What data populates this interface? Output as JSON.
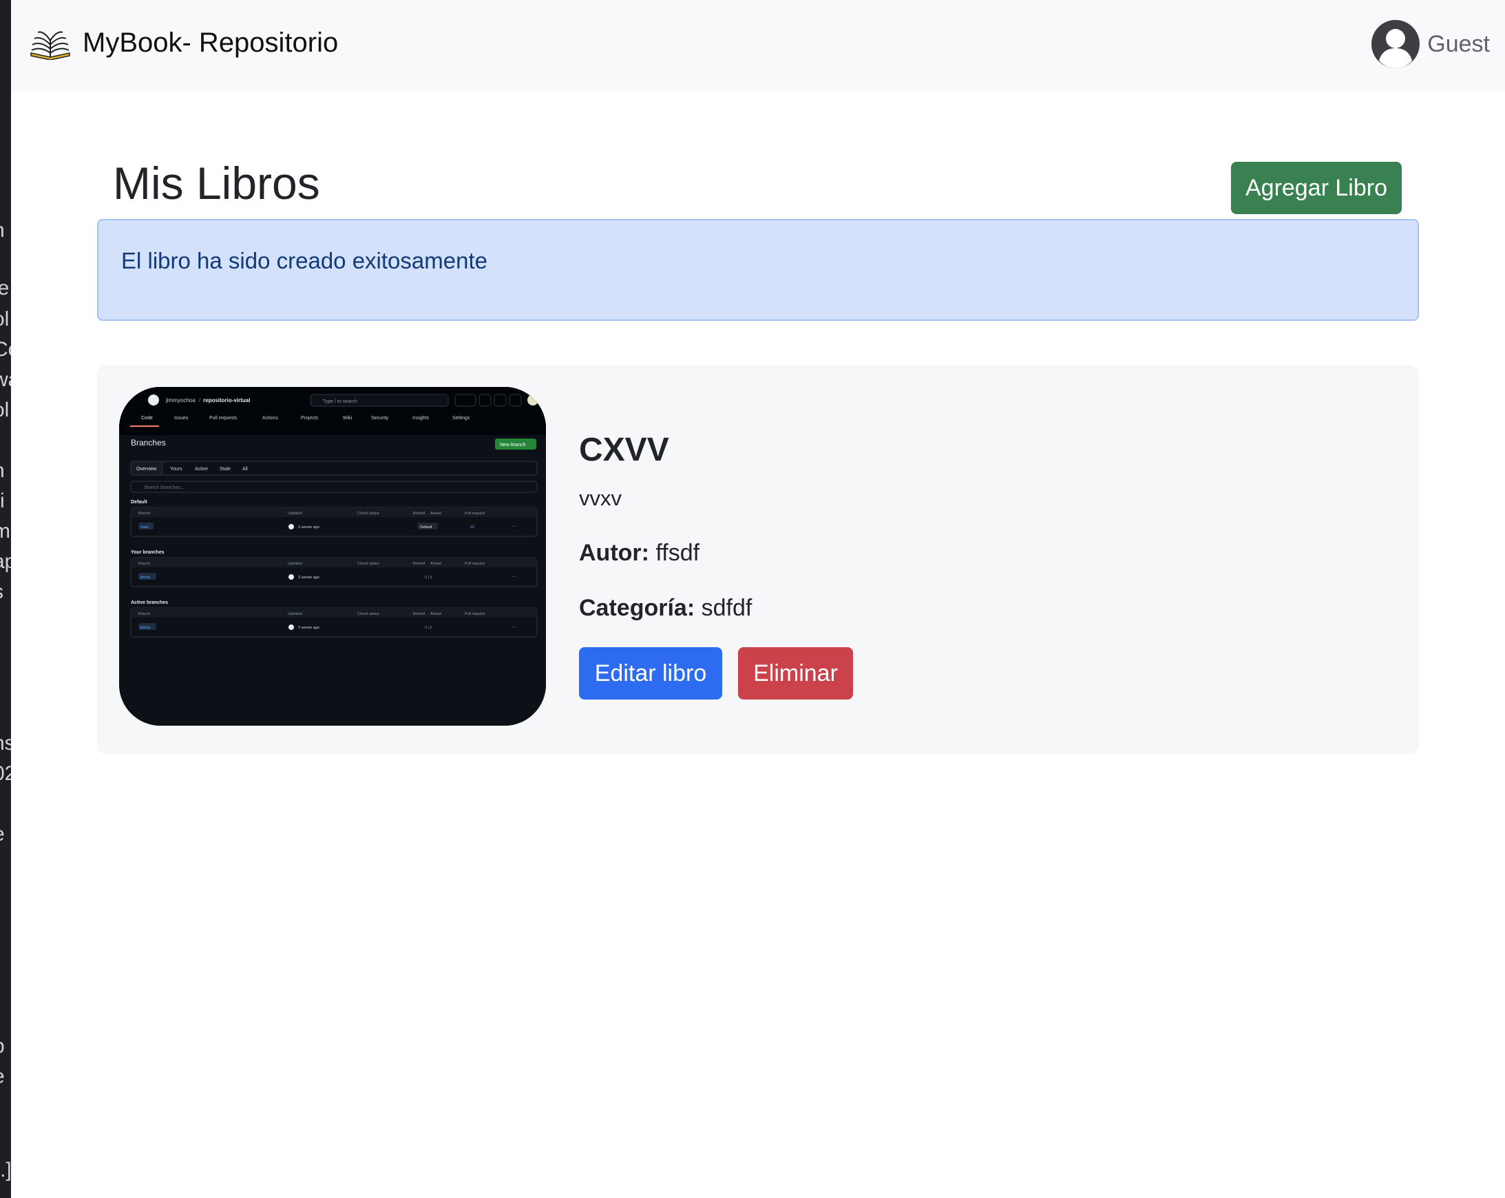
{
  "sidebar_fragments": [
    "n",
    "le",
    "ol",
    "Co",
    "wa",
    "ol",
    "h",
    "ri",
    "m",
    "ap",
    "s",
    "ns",
    "02",
    "e",
    "b",
    "e",
    "-.]"
  ],
  "navbar": {
    "brand": "MyBook- Repositorio",
    "logo_icon": "open-book-icon",
    "user_icon": "user-avatar-icon",
    "user_name": "Guest"
  },
  "header": {
    "title": "Mis Libros",
    "add_button": "Agregar Libro"
  },
  "alert": {
    "message": "El libro ha sido creado exitosamente"
  },
  "book": {
    "title": "CXVV",
    "description": "vvxv",
    "author_label": "Autor:",
    "author": "ffsdf",
    "category_label": "Categoría:",
    "category": "sdfdf",
    "edit_button": "Editar libro",
    "delete_button": "Eliminar",
    "cover": {
      "owner": "jimmyochoa",
      "repo": "repositorio-virtual",
      "search": "Type / to search",
      "tabs": [
        "Code",
        "Issues",
        "Pull requests",
        "Actions",
        "Projects",
        "Wiki",
        "Security",
        "Insights",
        "Settings"
      ],
      "heading": "Branches",
      "new_branch": "New branch",
      "filters": [
        "Overview",
        "Yours",
        "Active",
        "Stale",
        "All"
      ],
      "search_branches": "Search branches...",
      "columns": [
        "Branch",
        "Updated",
        "Check status",
        "Behind",
        "Ahead",
        "Pull request"
      ],
      "sections": [
        {
          "name": "Default",
          "branch": "main",
          "updated": "2 weeks ago",
          "status": "Default",
          "pr": "#2"
        },
        {
          "name": "Your branches",
          "branch": "jimmy",
          "updated": "2 weeks ago",
          "status": "0 | 0",
          "pr": ""
        },
        {
          "name": "Active branches",
          "branch": "jimmy",
          "updated": "2 weeks ago",
          "status": "0 | 0",
          "pr": ""
        }
      ]
    }
  },
  "colors": {
    "navbar_bg": "#f8f9fa",
    "success": "#3a8152",
    "primary": "#2d6cf0",
    "danger": "#cc424b",
    "alert_bg": "#d3e1fb",
    "alert_text": "#123a78"
  }
}
